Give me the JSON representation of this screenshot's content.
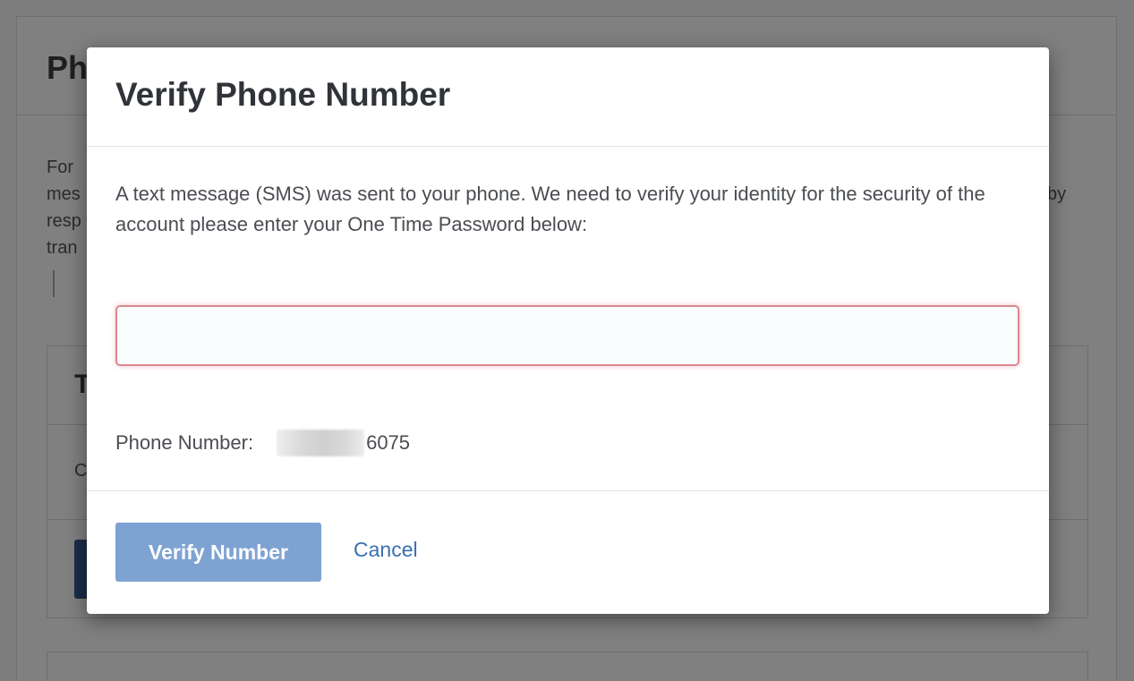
{
  "background": {
    "title": "Ph",
    "text_lines": [
      "For",
      "mes",
      "resp",
      "tran"
    ],
    "text_right_fragment": "by",
    "card_title": "T",
    "card_letter": "C"
  },
  "modal": {
    "title": "Verify Phone Number",
    "message": "A text message (SMS) was sent to your phone. We need to verify your identity for the security of the account please enter your One Time Password below:",
    "otp_input": {
      "value": "",
      "placeholder": ""
    },
    "phone_label": "Phone Number:",
    "phone_visible_digits": "6075",
    "verify_label": "Verify Number",
    "cancel_label": "Cancel"
  },
  "colors": {
    "overlay": "#7d7d7d",
    "primary_button": "#7ea3d3",
    "link": "#3a6fb0",
    "input_error_border": "#d8898f"
  }
}
